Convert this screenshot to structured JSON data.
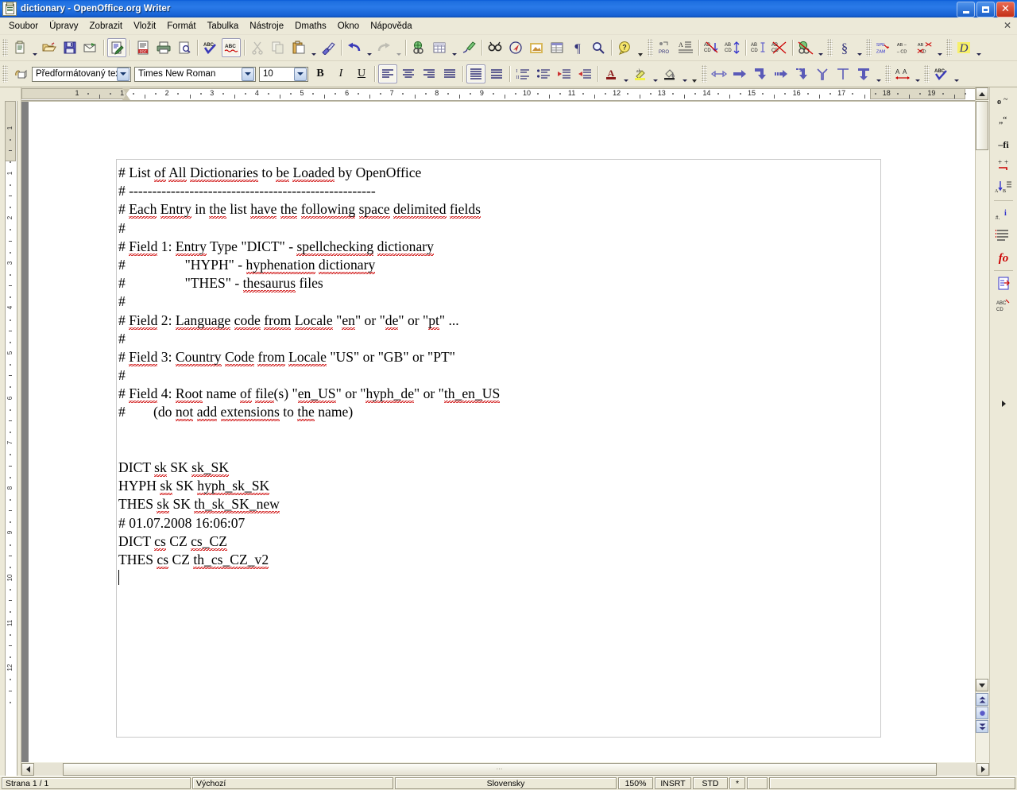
{
  "window": {
    "title": "dictionary - OpenOffice.org Writer",
    "icon": "writer-document-icon",
    "minimize_label": "",
    "maximize_label": "",
    "close_label": "✕"
  },
  "menubar": {
    "items": [
      {
        "label": "Soubor",
        "name": "menu-soubor"
      },
      {
        "label": "Úpravy",
        "name": "menu-upravy"
      },
      {
        "label": "Zobrazit",
        "name": "menu-zobrazit"
      },
      {
        "label": "Vložit",
        "name": "menu-vlozit"
      },
      {
        "label": "Formát",
        "name": "menu-format"
      },
      {
        "label": "Tabulka",
        "name": "menu-tabulka"
      },
      {
        "label": "Nástroje",
        "name": "menu-nastroje"
      },
      {
        "label": "Dmaths",
        "name": "menu-dmaths"
      },
      {
        "label": "Okno",
        "name": "menu-okno"
      },
      {
        "label": "Nápověda",
        "name": "menu-napoveda"
      }
    ],
    "close_document": "✕"
  },
  "standard_toolbar": {
    "icons": [
      "new-document-icon",
      "open-folder-icon",
      "save-icon",
      "email-icon",
      "edit-file-icon",
      "export-pdf-icon",
      "print-icon",
      "print-preview-icon",
      "spellcheck-icon",
      "autospellcheck-icon",
      "cut-icon",
      "copy-icon",
      "paste-icon",
      "clone-formatting-icon",
      "undo-icon",
      "redo-icon",
      "hyperlink-icon",
      "table-icon",
      "show-draw-functions-icon",
      "find-replace-icon",
      "navigator-icon",
      "gallery-icon",
      "data-sources-icon",
      "formatting-marks-icon",
      "zoom-icon",
      "help-icon"
    ]
  },
  "dmaths_toolbar": {
    "icons": [
      "dmaths-pro-icon",
      "dmaths-text-icon",
      "dmaths-abcd-down-icon",
      "dmaths-abcd-updown-icon",
      "dmaths-abcd-i-icon",
      "dmaths-abcd-del-icon",
      "dmaths-globe-del-icon",
      "dmaths-script-icon",
      "dmaths-spezam-icon",
      "dmaths-abcd-minus-icon",
      "dmaths-abcd-cross-icon",
      "dmaths-d-icon"
    ]
  },
  "formatting_toolbar": {
    "apply_style_icon": "apply-style-icon",
    "paragraph_style": "Předformátovaný text",
    "font_name": "Times New Roman",
    "font_size": "10",
    "bold_label": "B",
    "italic_label": "I",
    "underline_label": "U",
    "icons": [
      "align-left-icon",
      "align-center-icon",
      "align-right-icon",
      "align-justified-icon",
      "line-spacing-1-icon",
      "line-spacing-2-icon",
      "ordered-list-icon",
      "unordered-list-icon",
      "decrease-indent-icon",
      "increase-indent-icon",
      "font-color-icon",
      "highlighting-icon",
      "background-color-icon"
    ],
    "extra_icons": [
      "resize-horizontal-icon",
      "arrow-right-icon",
      "corner-down-icon",
      "dashed-arrow-icon",
      "corner-down2-icon",
      "anchor-top-icon",
      "anchor-t-icon",
      "anchor-t-fill-icon",
      "character-spacing-icon",
      "spellcheck-check-icon"
    ]
  },
  "ruler": {
    "horizontal_ticks": [
      "1",
      "1",
      "2",
      "3",
      "4",
      "5",
      "6",
      "7",
      "8",
      "9",
      "10",
      "11",
      "12",
      "13",
      "14",
      "15",
      "16",
      "17",
      "18",
      "19"
    ],
    "vertical_ticks": [
      "1",
      "1",
      "2",
      "3",
      "4",
      "5",
      "6",
      "7",
      "8",
      "9",
      "10",
      "11",
      "12"
    ],
    "tab_marker": "left-tab-icon"
  },
  "document": {
    "lines": [
      "# List of All Dictionaries to be Loaded by OpenOffice",
      "# -----------------------------------------------------",
      "# Each Entry in the list have the following space delimited fields",
      "#",
      "# Field 1: Entry Type \"DICT\" - spellchecking dictionary",
      "#                 \"HYPH\" - hyphenation dictionary",
      "#                 \"THES\" - thesaurus files",
      "#",
      "# Field 2: Language code from Locale \"en\" or \"de\" or \"pt\" ...",
      "#",
      "# Field 3: Country Code from Locale \"US\" or \"GB\" or \"PT\"",
      "#",
      "# Field 4: Root name of file(s) \"en_US\" or \"hyph_de\" or \"th_en_US",
      "#        (do not add extensions to the name)",
      "",
      "",
      "DICT sk SK sk_SK",
      "HYPH sk SK hyph_sk_SK",
      "THES sk SK th_sk_SK_new",
      "# 01.07.2008 16:06:07",
      "DICT cs CZ cs_CZ",
      "THES cs CZ th_cs_CZ_v2"
    ]
  },
  "sidebar_tools": {
    "icons": [
      "omega-tilde-icon",
      "quotes-icon",
      "ligature-fi-icon",
      "accent-marks-icon",
      "sort-ab-icon",
      "index-entry-icon",
      "list-format-icon",
      "fo-function-icon",
      "insert-field-icon",
      "abcd-icon"
    ]
  },
  "scrollbars": {
    "up_arrow": "scroll-up-icon",
    "down_arrow": "scroll-down-icon",
    "left_arrow": "scroll-left-icon",
    "right_arrow": "scroll-right-icon",
    "previous_page": "previous-page-icon",
    "navigation": "navigation-icon",
    "next_page": "next-page-icon"
  },
  "statusbar": {
    "page": "Strana 1 / 1",
    "page_style": "Výchozí",
    "language": "Slovensky",
    "zoom": "150%",
    "insert_mode": "INSRT",
    "selection_mode": "STD",
    "modified": "*",
    "signature": "",
    "info": ""
  },
  "colors": {
    "title_bar": "#1e6fe0",
    "toolbar_bg": "#ece9d8",
    "page_bg": "#ffffff",
    "spell_underline": "#cc0000",
    "accent_purple": "#33337a"
  }
}
